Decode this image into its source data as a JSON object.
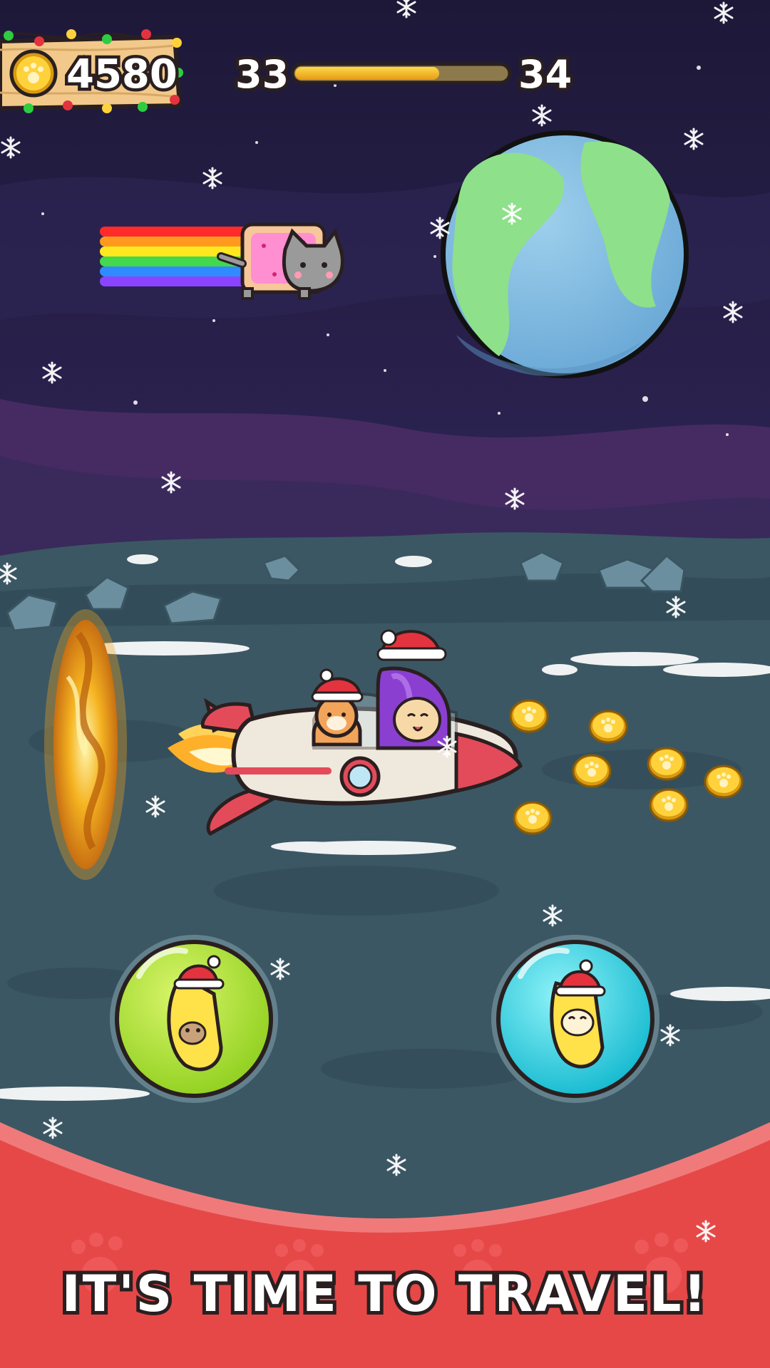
{
  "hud": {
    "coins": "4580",
    "level_current": "33",
    "level_next": "34",
    "level_progress": 0.68
  },
  "banner": {
    "text": "IT'S TIME TO TRAVEL!"
  },
  "icons": {
    "coin": "paw-coin-icon",
    "snowflake": "snowflake-icon"
  },
  "colors": {
    "sky": "#25204a",
    "ground": "#3b5763",
    "banner": "#e64848",
    "progress_fill": "#f5b52a",
    "bubble_green": "#b6e635",
    "bubble_cyan": "#33d6e3"
  }
}
